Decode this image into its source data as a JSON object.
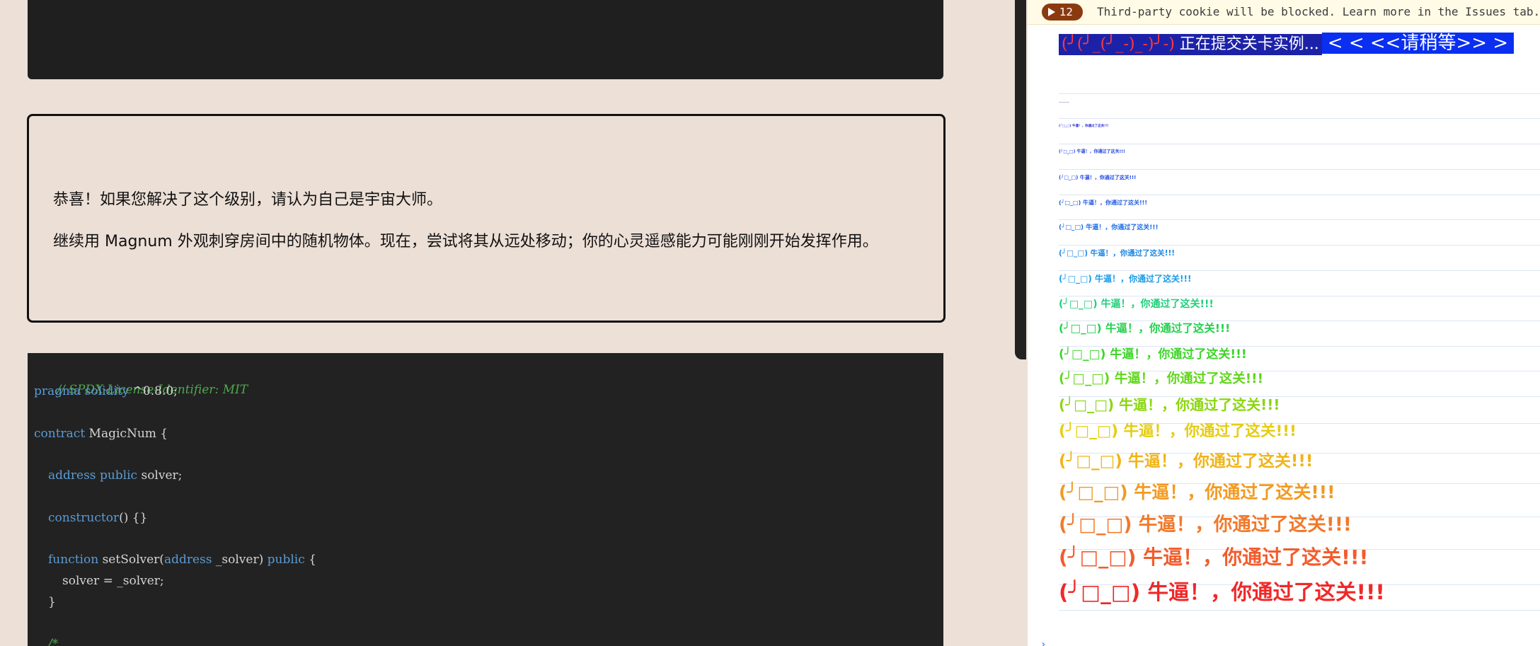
{
  "message": {
    "line1": "恭喜！如果您解决了这个级别，请认为自己是宇宙大师。",
    "line2": "继续用 Magnum 外观刺穿房间中的随机物体。现在，尝试将其从远处移动；你的心灵遥感能力可能刚刚开始发挥作用。"
  },
  "code": {
    "comment": "// SPDX-License-Identifier: MIT",
    "pragma_kw": "pragma solidity",
    "pragma_ver": " ^0.8.0;",
    "contract_kw": "contract",
    "contract_name": " MagicNum {",
    "address_kw": "address public",
    "address_var": " solver;",
    "constructor_kw": "constructor",
    "constructor_rest": "() {}",
    "function_kw": "function",
    "function_name": " setSolver(",
    "param_kw": "address",
    "param_name": " _solver) ",
    "public_kw": "public",
    "function_open": " {",
    "assign": "solver = _solver;",
    "close_brace": "}",
    "comment_start": "/*"
  },
  "console": {
    "issues_count": "12",
    "issues_text": "Third-party cookie will be blocked. Learn more in the Issues tab.",
    "banner_part1_red1": "(╯(╯_(╯_-)_-)╯-)",
    "banner_part1_text": " 正在提交关卡实例...",
    "banner_part2": "< < <<请稍等>> >",
    "messages": [
      {
        "text": "—————",
        "color": "#3a1fa0"
      },
      {
        "text": "(╯□_□) 牛逼！，你通过了这关!!!",
        "color": "#2a2fd0"
      },
      {
        "text": "(╯□_□) 牛逼！，你通过了这关!!!",
        "color": "#1f3fe0"
      },
      {
        "text": "(╯□_□) 牛逼！，你通过了这关!!!",
        "color": "#1f49e8"
      },
      {
        "text": "(╯□_□) 牛逼！，你通过了这关!!!",
        "color": "#1e5ae8"
      },
      {
        "text": "(╯□_□) 牛逼！，你通过了这关!!!",
        "color": "#1e6de6"
      },
      {
        "text": "(╯□_□) 牛逼！，你通过了这关!!!",
        "color": "#1f88e4"
      },
      {
        "text": "(╯□_□) 牛逼！，你通过了这关!!!",
        "color": "#1c9be8"
      },
      {
        "text": "(╯□_□) 牛逼！，你通过了这关!!!",
        "color": "#1fd07a"
      },
      {
        "text": "(╯□_□) 牛逼！，你通过了这关!!!",
        "color": "#22d04c"
      },
      {
        "text": "(╯□_□) 牛逼！，你通过了这关!!!",
        "color": "#3ed42a"
      },
      {
        "text": "(╯□_□) 牛逼！，你通过了这关!!!",
        "color": "#60d61a"
      },
      {
        "text": "(╯□_□) 牛逼！，你通过了这关!!!",
        "color": "#8ad60f"
      },
      {
        "text": "(╯□_□) 牛逼！，你通过了这关!!!",
        "color": "#e6cc10"
      },
      {
        "text": "(╯□_□) 牛逼！，你通过了这关!!!",
        "color": "#f0b418"
      },
      {
        "text": "(╯□_□) 牛逼！，你通过了这关!!!",
        "color": "#f29a22"
      },
      {
        "text": "(╯□_□) 牛逼！，你通过了这关!!!",
        "color": "#f2792a"
      },
      {
        "text": "(╯□_□) 牛逼！，你通过了这关!!!",
        "color": "#f25c2c"
      },
      {
        "text": "(╯□_□) 牛逼！，你通过了这关!!!",
        "color": "#f02828"
      }
    ]
  }
}
